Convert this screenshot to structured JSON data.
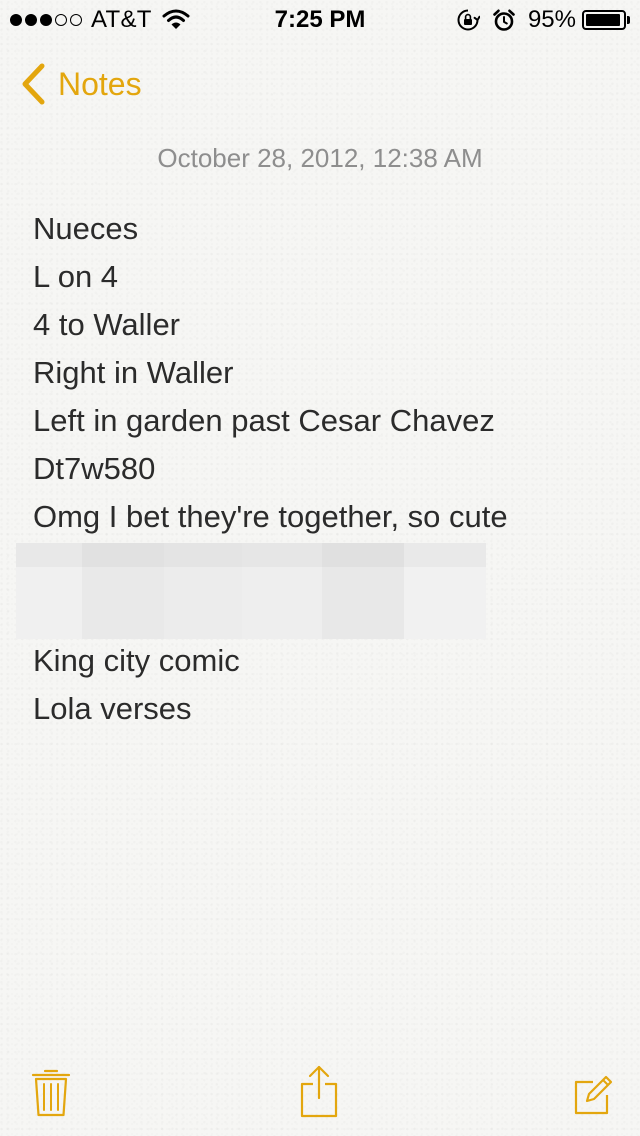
{
  "status_bar": {
    "carrier": "AT&T",
    "time": "7:25 PM",
    "battery_percent": "95%",
    "battery_level": 0.95,
    "signal_bars_filled": 3,
    "signal_bars_total": 5,
    "icons": [
      "wifi-icon",
      "orientation-lock-icon",
      "alarm-icon",
      "battery-icon"
    ]
  },
  "nav": {
    "back_label": "Notes",
    "back_icon": "chevron-left-icon"
  },
  "note": {
    "date": "October 28, 2012, 12:38 AM",
    "lines": [
      "Nueces",
      "L on 4",
      "4 to Waller",
      "Right in Waller",
      "Left in garden past Cesar Chavez",
      "Dt7w580",
      "Omg I bet they're together, so cute"
    ],
    "lines_after": [
      "King city comic",
      "Lola verses"
    ]
  },
  "toolbar": {
    "icons": [
      "trash-icon",
      "share-icon",
      "compose-icon"
    ]
  },
  "colors": {
    "accent": "#e3a60e",
    "date_text": "#8e8e8e",
    "body_text": "#2b2b2b",
    "background": "#f6f6f4"
  }
}
